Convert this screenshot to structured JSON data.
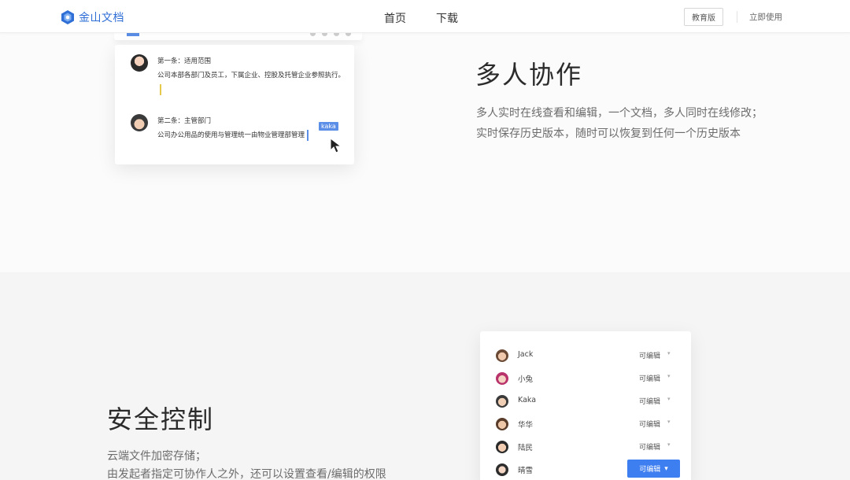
{
  "header": {
    "logo_text": "金山文档",
    "nav": [
      "首页",
      "下载"
    ],
    "edu_label": "教育版",
    "start_label": "立即使用"
  },
  "section1": {
    "title": "多人协作",
    "desc_lines": [
      "多人实时在线查看和编辑，一个文档，多人同时在线修改；",
      "实时保存历史版本，随时可以恢复到任何一个历史版本"
    ],
    "card": {
      "entry1_title": "第一条：适用范围",
      "entry1_body": "公司本部各部门及员工，下属企业、控股及托管企业参照执行。",
      "entry2_title": "第二条：主管部门",
      "entry2_body": "公司办公用品的使用与管理统一由物业管理部管理",
      "cursor_tag": "kaka"
    }
  },
  "section2": {
    "title": "安全控制",
    "desc_lines": [
      "云端文件加密存储；",
      "由发起者指定可协作人之外，还可以设置查看/编辑的权限"
    ],
    "permissions": [
      {
        "name": "Jack",
        "perm": "可编辑"
      },
      {
        "name": "小兔",
        "perm": "可编辑"
      },
      {
        "name": "Kaka",
        "perm": "可编辑"
      },
      {
        "name": "华华",
        "perm": "可编辑"
      },
      {
        "name": "陆民",
        "perm": "可编辑"
      },
      {
        "name": "晴雪",
        "perm": "可编辑",
        "highlighted": true
      }
    ]
  },
  "colors": {
    "brand_blue": "#2f6fd6",
    "accent_blue": "#3d7ef0",
    "cursor_yellow": "#e5c94a"
  },
  "icons": [
    "logo-icon",
    "mouse-pointer-icon",
    "caret-down-icon"
  ]
}
